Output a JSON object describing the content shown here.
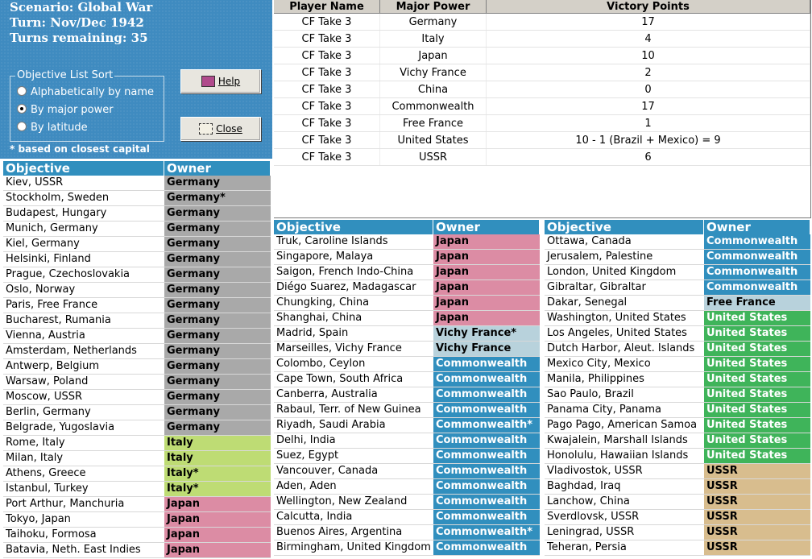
{
  "scenario": {
    "scenario_line": "Scenario: Global War",
    "turn_line": "Turn: Nov/Dec 1942",
    "turns_line": "Turns remaining: 35"
  },
  "sort": {
    "legend": "Objective List Sort",
    "options": [
      "Alphabetically by name",
      "By major power",
      "By latitude"
    ],
    "selected": 1,
    "note": "* based on closest capital"
  },
  "buttons": {
    "help": "Help",
    "close": "Close"
  },
  "colors": {
    "Germany": "#a9a9a9",
    "Italy": "#bedc74",
    "Japan": "#dc8ca4",
    "Vichy France": "#b8d2dc",
    "Commonwealth": "#318fbe",
    "Free France": "#b8d2dc",
    "United States": "#3fb45a",
    "USSR": "#d8bd8e"
  },
  "owner_text_colors": {
    "Germany": "#000000",
    "Italy": "#000000",
    "Japan": "#000000",
    "Vichy France": "#000000",
    "Commonwealth": "#ffffff",
    "Free France": "#000000",
    "United States": "#ffffff",
    "USSR": "#000000"
  },
  "victory": {
    "headers": [
      "Player Name",
      "Major Power",
      "Victory Points"
    ],
    "rows": [
      [
        "CF Take 3",
        "Germany",
        "17"
      ],
      [
        "CF Take 3",
        "Italy",
        "4"
      ],
      [
        "CF Take 3",
        "Japan",
        "10"
      ],
      [
        "CF Take 3",
        "Vichy France",
        "2"
      ],
      [
        "CF Take 3",
        "China",
        "0"
      ],
      [
        "CF Take 3",
        "Commonwealth",
        "17"
      ],
      [
        "CF Take 3",
        "Free France",
        "1"
      ],
      [
        "CF Take 3",
        "United States",
        "10 - 1 (Brazil + Mexico) = 9"
      ],
      [
        "CF Take 3",
        "USSR",
        "6"
      ]
    ]
  },
  "list_headers": {
    "objective": "Objective",
    "owner": "Owner"
  },
  "lists": [
    [
      [
        "Kiev, USSR",
        "Germany",
        "Germany"
      ],
      [
        "Stockholm, Sweden",
        "Germany*",
        "Germany"
      ],
      [
        "Budapest, Hungary",
        "Germany",
        "Germany"
      ],
      [
        "Munich, Germany",
        "Germany",
        "Germany"
      ],
      [
        "Kiel, Germany",
        "Germany",
        "Germany"
      ],
      [
        "Helsinki, Finland",
        "Germany",
        "Germany"
      ],
      [
        "Prague, Czechoslovakia",
        "Germany",
        "Germany"
      ],
      [
        "Oslo, Norway",
        "Germany",
        "Germany"
      ],
      [
        "Paris, Free France",
        "Germany",
        "Germany"
      ],
      [
        "Bucharest, Rumania",
        "Germany",
        "Germany"
      ],
      [
        "Vienna, Austria",
        "Germany",
        "Germany"
      ],
      [
        "Amsterdam, Netherlands",
        "Germany",
        "Germany"
      ],
      [
        "Antwerp, Belgium",
        "Germany",
        "Germany"
      ],
      [
        "Warsaw, Poland",
        "Germany",
        "Germany"
      ],
      [
        "Moscow, USSR",
        "Germany",
        "Germany"
      ],
      [
        "Berlin, Germany",
        "Germany",
        "Germany"
      ],
      [
        "Belgrade, Yugoslavia",
        "Germany",
        "Germany"
      ],
      [
        "Rome, Italy",
        "Italy",
        "Italy"
      ],
      [
        "Milan, Italy",
        "Italy",
        "Italy"
      ],
      [
        "Athens, Greece",
        "Italy*",
        "Italy"
      ],
      [
        "Istanbul, Turkey",
        "Italy*",
        "Italy"
      ],
      [
        "Port Arthur, Manchuria",
        "Japan",
        "Japan"
      ],
      [
        "Tokyo, Japan",
        "Japan",
        "Japan"
      ],
      [
        "Taihoku, Formosa",
        "Japan",
        "Japan"
      ],
      [
        "Batavia, Neth. East Indies",
        "Japan",
        "Japan"
      ]
    ],
    [
      [
        "Truk, Caroline Islands",
        "Japan",
        "Japan"
      ],
      [
        "Singapore, Malaya",
        "Japan",
        "Japan"
      ],
      [
        "Saigon, French Indo-China",
        "Japan",
        "Japan"
      ],
      [
        "Diégo Suarez, Madagascar",
        "Japan",
        "Japan"
      ],
      [
        "Chungking, China",
        "Japan",
        "Japan"
      ],
      [
        "Shanghai, China",
        "Japan",
        "Japan"
      ],
      [
        "Madrid, Spain",
        "Vichy France*",
        "Vichy France"
      ],
      [
        "Marseilles, Vichy France",
        "Vichy France",
        "Vichy France"
      ],
      [
        "Colombo, Ceylon",
        "Commonwealth",
        "Commonwealth"
      ],
      [
        "Cape Town, South Africa",
        "Commonwealth",
        "Commonwealth"
      ],
      [
        "Canberra, Australia",
        "Commonwealth",
        "Commonwealth"
      ],
      [
        "Rabaul, Terr. of New Guinea",
        "Commonwealth",
        "Commonwealth"
      ],
      [
        "Riyadh, Saudi Arabia",
        "Commonwealth*",
        "Commonwealth"
      ],
      [
        "Delhi, India",
        "Commonwealth",
        "Commonwealth"
      ],
      [
        "Suez, Egypt",
        "Commonwealth",
        "Commonwealth"
      ],
      [
        "Vancouver, Canada",
        "Commonwealth",
        "Commonwealth"
      ],
      [
        "Aden, Aden",
        "Commonwealth",
        "Commonwealth"
      ],
      [
        "Wellington, New Zealand",
        "Commonwealth",
        "Commonwealth"
      ],
      [
        "Calcutta, India",
        "Commonwealth",
        "Commonwealth"
      ],
      [
        "Buenos Aires, Argentina",
        "Commonwealth*",
        "Commonwealth"
      ],
      [
        "Birmingham, United Kingdom",
        "Commonwealth",
        "Commonwealth"
      ]
    ],
    [
      [
        "Ottawa, Canada",
        "Commonwealth",
        "Commonwealth"
      ],
      [
        "Jerusalem, Palestine",
        "Commonwealth",
        "Commonwealth"
      ],
      [
        "London, United Kingdom",
        "Commonwealth",
        "Commonwealth"
      ],
      [
        "Gibraltar, Gibraltar",
        "Commonwealth",
        "Commonwealth"
      ],
      [
        "Dakar, Senegal",
        "Free France",
        "Free France"
      ],
      [
        "Washington, United States",
        "United States",
        "United States"
      ],
      [
        "Los Angeles, United States",
        "United States",
        "United States"
      ],
      [
        "Dutch Harbor, Aleut. Islands",
        "United States",
        "United States"
      ],
      [
        "Mexico City, Mexico",
        "United States",
        "United States"
      ],
      [
        "Manila, Philippines",
        "United States",
        "United States"
      ],
      [
        "Sao Paulo, Brazil",
        "United States",
        "United States"
      ],
      [
        "Panama City, Panama",
        "United States",
        "United States"
      ],
      [
        "Pago Pago, American Samoa",
        "United States",
        "United States"
      ],
      [
        "Kwajalein, Marshall Islands",
        "United States",
        "United States"
      ],
      [
        "Honolulu, Hawaiian Islands",
        "United States",
        "United States"
      ],
      [
        "Vladivostok, USSR",
        "USSR",
        "USSR"
      ],
      [
        "Baghdad, Iraq",
        "USSR",
        "USSR"
      ],
      [
        "Lanchow, China",
        "USSR",
        "USSR"
      ],
      [
        "Sverdlovsk, USSR",
        "USSR",
        "USSR"
      ],
      [
        "Leningrad, USSR",
        "USSR",
        "USSR"
      ],
      [
        "Teheran, Persia",
        "USSR",
        "USSR"
      ]
    ]
  ]
}
